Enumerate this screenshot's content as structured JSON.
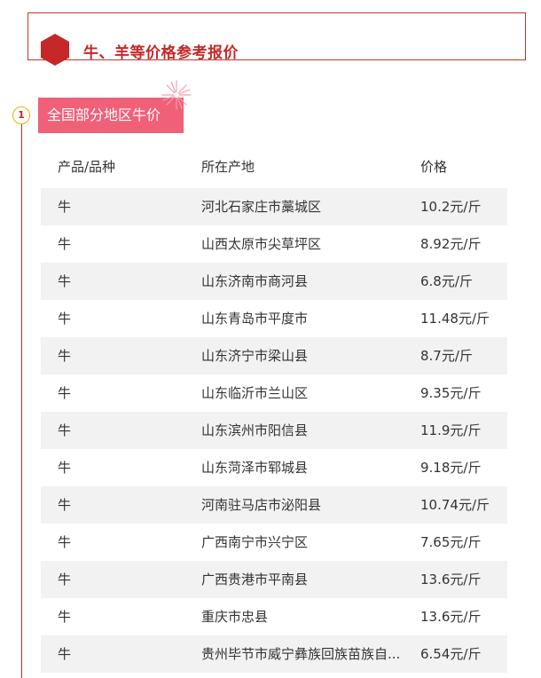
{
  "header": {
    "title": "牛、羊等价格参考报价"
  },
  "section": {
    "number": "1",
    "label": "全国部分地区牛价"
  },
  "table": {
    "columns": [
      "产品/品种",
      "所在产地",
      "价格"
    ],
    "rows": [
      [
        "牛",
        "河北石家庄市藁城区",
        "10.2元/斤"
      ],
      [
        "牛",
        "山西太原市尖草坪区",
        "8.92元/斤"
      ],
      [
        "牛",
        "山东济南市商河县",
        "6.8元/斤"
      ],
      [
        "牛",
        "山东青岛市平度市",
        "11.48元/斤"
      ],
      [
        "牛",
        "山东济宁市梁山县",
        "8.7元/斤"
      ],
      [
        "牛",
        "山东临沂市兰山区",
        "9.35元/斤"
      ],
      [
        "牛",
        "山东滨州市阳信县",
        "11.9元/斤"
      ],
      [
        "牛",
        "山东菏泽市郓城县",
        "9.18元/斤"
      ],
      [
        "牛",
        "河南驻马店市泌阳县",
        "10.74元/斤"
      ],
      [
        "牛",
        "广西南宁市兴宁区",
        "7.65元/斤"
      ],
      [
        "牛",
        "广西贵港市平南县",
        "13.6元/斤"
      ],
      [
        "牛",
        "重庆市忠县",
        "13.6元/斤"
      ],
      [
        "牛",
        "贵州毕节市威宁彝族回族苗族自...",
        "6.54元/斤"
      ]
    ]
  },
  "colors": {
    "accent": "#c62828",
    "label_bg": "#f06078",
    "row_shade": "#f2f2f2"
  }
}
